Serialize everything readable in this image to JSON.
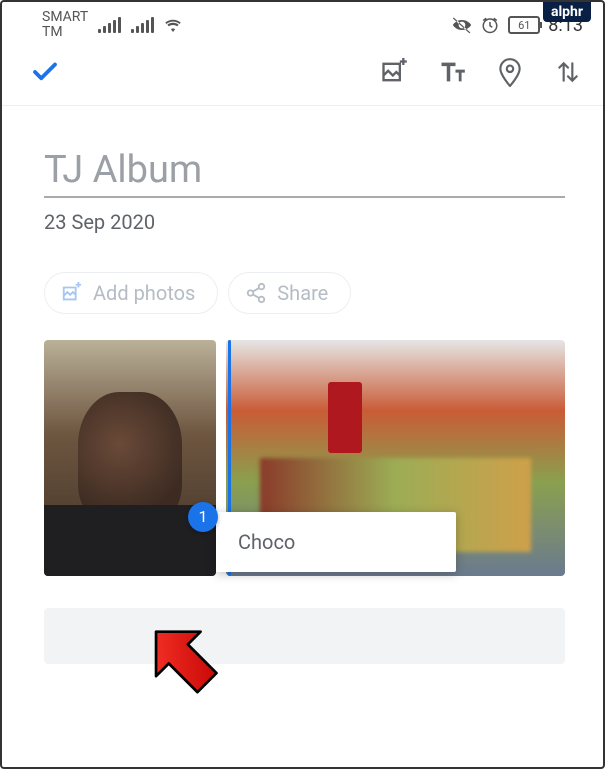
{
  "watermark": "alphr",
  "status": {
    "carrier_line1": "SMART",
    "carrier_line2": "TM",
    "battery": "61",
    "time": "8:13"
  },
  "toolbar": {
    "confirm_icon": "check-icon",
    "add_photo_icon": "image-plus-icon",
    "text_icon": "text-tt-icon",
    "location_icon": "location-pin-icon",
    "sort_icon": "sort-arrows-icon"
  },
  "album": {
    "title": "TJ Album",
    "date": "23 Sep 2020"
  },
  "actions": {
    "add_photos": "Add photos",
    "share": "Share"
  },
  "caption": {
    "badge": "1",
    "text": "Choco"
  }
}
